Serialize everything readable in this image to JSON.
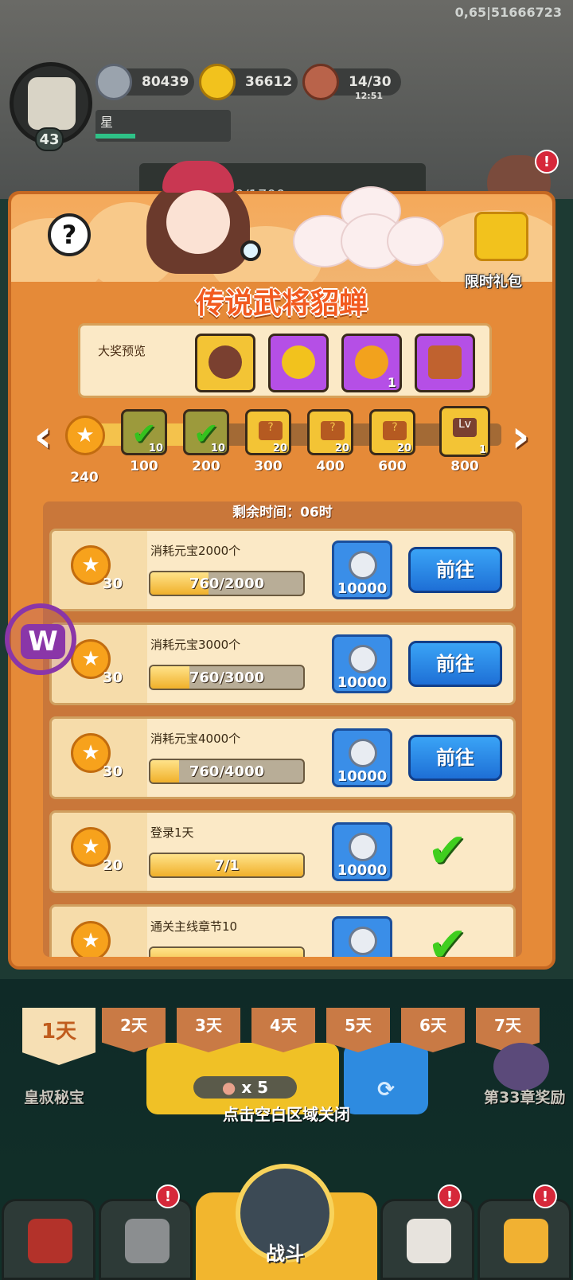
{
  "hud": {
    "coord_text": "0,65|51666723",
    "level": "43",
    "player_name": "星",
    "silver": "80439",
    "gold": "36612",
    "stamina": "14/30",
    "stamina_timer": "12:51",
    "progress_text": "0/1700"
  },
  "dialog": {
    "title": "传说武将貂蝉",
    "gift_label": "限时礼包",
    "preview_label": "大奖预览",
    "preview_items": [
      {
        "icon": "hero-diaochan-icon",
        "count": ""
      },
      {
        "icon": "purple-chest-icon",
        "count": ""
      },
      {
        "icon": "lion-chest-icon",
        "count": "1"
      },
      {
        "icon": "food-box-icon",
        "count": ""
      }
    ],
    "points_current": "240",
    "milestones": [
      {
        "points": "100",
        "state": "claimed",
        "count": "10"
      },
      {
        "points": "200",
        "state": "claimed",
        "count": "10"
      },
      {
        "points": "300",
        "state": "chest",
        "count": "20"
      },
      {
        "points": "400",
        "state": "chest",
        "count": "20"
      },
      {
        "points": "600",
        "state": "chest",
        "count": "20"
      },
      {
        "points": "800",
        "state": "hero",
        "count": "1"
      }
    ],
    "remaining_time": "剩余时间：06时",
    "tasks": [
      {
        "desc": "消耗元宝2000个",
        "points": "30",
        "progress_text": "760/2000",
        "progress": 0.38,
        "reward": "10000",
        "action": "前往",
        "done": false
      },
      {
        "desc": "消耗元宝3000个",
        "points": "30",
        "progress_text": "760/3000",
        "progress": 0.253,
        "reward": "10000",
        "action": "前往",
        "done": false
      },
      {
        "desc": "消耗元宝4000个",
        "points": "30",
        "progress_text": "760/4000",
        "progress": 0.19,
        "reward": "10000",
        "action": "前往",
        "done": false
      },
      {
        "desc": "登录1天",
        "points": "20",
        "progress_text": "7/1",
        "progress": 1.0,
        "reward": "10000",
        "action": "",
        "done": true
      },
      {
        "desc": "通关主线章节10",
        "points": "",
        "progress_text": "",
        "progress": 1.0,
        "reward": "",
        "action": "",
        "done": true
      }
    ],
    "days": [
      "1天",
      "2天",
      "3天",
      "4天",
      "5天",
      "6天",
      "7天"
    ]
  },
  "background": {
    "stamina_cost": "x 5",
    "close_hint": "点击空白区域关闭",
    "left_event": "皇叔秘宝",
    "right_event": "第33章奖励",
    "battle_label": "战斗",
    "alert_mark": "!"
  },
  "colors": {
    "dialog_orange": "#e58a38",
    "button_blue": "#1e6fd6",
    "check_green": "#3fce1f",
    "title_orange": "#f25a1f"
  }
}
